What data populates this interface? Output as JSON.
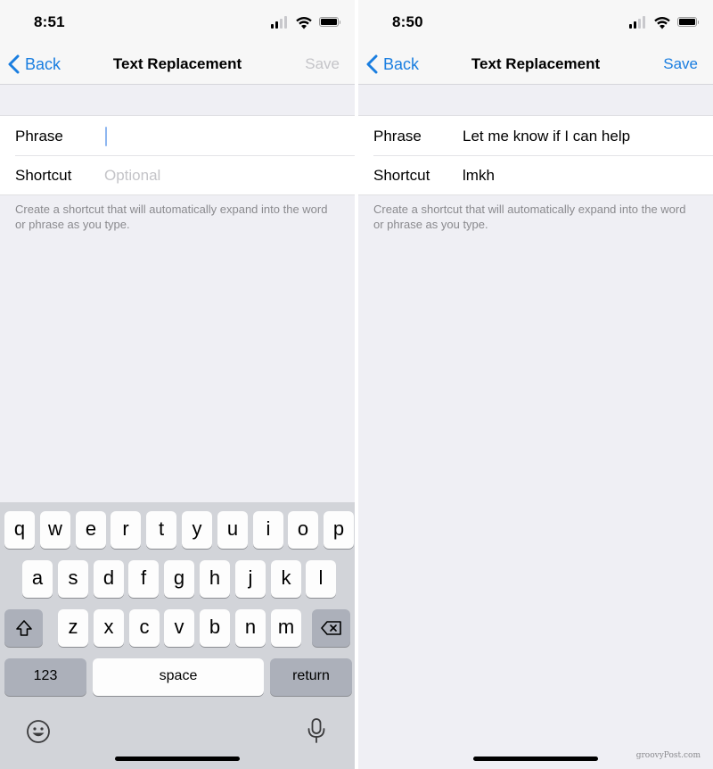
{
  "left": {
    "status": {
      "time": "8:51"
    },
    "nav": {
      "back": "Back",
      "title": "Text Replacement",
      "save": "Save",
      "save_enabled": false
    },
    "form": {
      "phrase_label": "Phrase",
      "phrase_value": "",
      "shortcut_label": "Shortcut",
      "shortcut_placeholder": "Optional"
    },
    "note": "Create a shortcut that will automatically expand into the word or phrase as you type.",
    "keyboard": {
      "row1": [
        "q",
        "w",
        "e",
        "r",
        "t",
        "y",
        "u",
        "i",
        "o",
        "p"
      ],
      "row2": [
        "a",
        "s",
        "d",
        "f",
        "g",
        "h",
        "j",
        "k",
        "l"
      ],
      "row3": [
        "z",
        "x",
        "c",
        "v",
        "b",
        "n",
        "m"
      ],
      "numbers": "123",
      "space": "space",
      "return": "return",
      "icons": {
        "shift": "shift-icon",
        "delete": "delete-icon",
        "emoji": "emoji-icon",
        "dictation": "microphone-icon"
      }
    }
  },
  "right": {
    "status": {
      "time": "8:50"
    },
    "nav": {
      "back": "Back",
      "title": "Text Replacement",
      "save": "Save",
      "save_enabled": true
    },
    "form": {
      "phrase_label": "Phrase",
      "phrase_value": "Let me know if I can help",
      "shortcut_label": "Shortcut",
      "shortcut_value": "lmkh"
    },
    "note": "Create a shortcut that will automatically expand into the word or phrase as you type."
  },
  "watermark": "groovyPost.com",
  "colors": {
    "accent": "#1a7ee0",
    "disabled": "#c4c4c8",
    "background": "#efeff4"
  }
}
